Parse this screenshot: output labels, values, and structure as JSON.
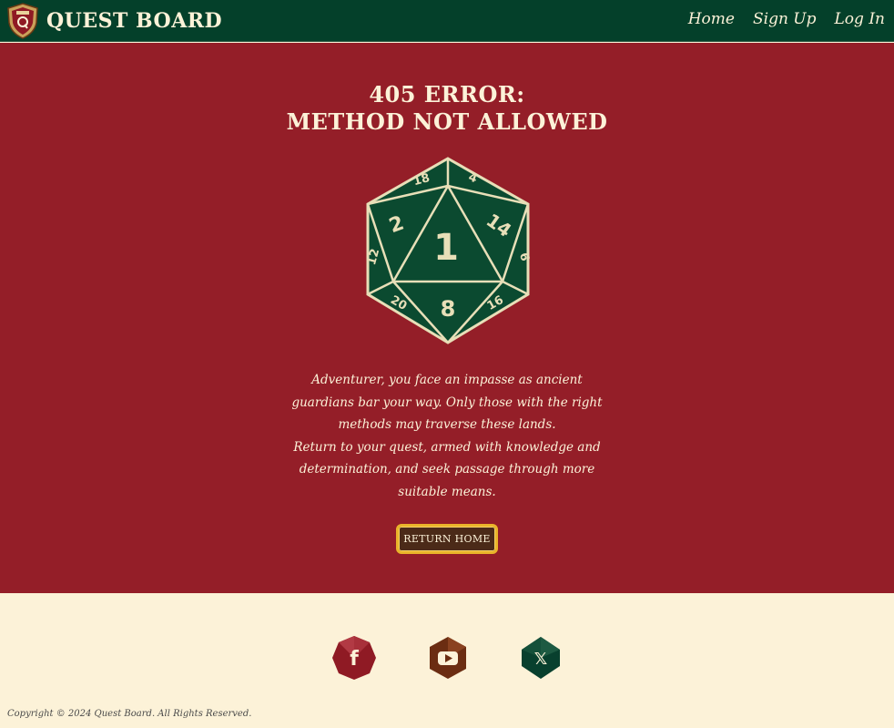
{
  "brand": {
    "name": "Quest Board",
    "logo_icon": "shield-logo-icon"
  },
  "nav": {
    "home": "Home",
    "sign_up": "Sign Up",
    "log_in": "Log In"
  },
  "error": {
    "title_line1": "405 Error:",
    "title_line2": "Method Not Allowed",
    "message_p1": "Adventurer, you face an impasse as ancient guardians bar your way. Only those with the right methods may traverse these lands.",
    "message_p2": "Return to your quest, armed with knowledge and determination, and seek passage through more suitable means.",
    "button": "Return Home"
  },
  "die": {
    "icon": "d20-die-icon",
    "faces": {
      "center": "1",
      "bottom": "8",
      "left": "2",
      "right": "14",
      "top_left": "18",
      "top_right": "4",
      "far_left": "12",
      "far_right": "6",
      "lower_left": "20",
      "lower_right": "16"
    }
  },
  "social": [
    {
      "name": "facebook",
      "icon": "facebook-icon",
      "glyph": "f",
      "color": "#8f1a24"
    },
    {
      "name": "youtube",
      "icon": "youtube-icon",
      "glyph": "▶",
      "color": "#6b2d12"
    },
    {
      "name": "x",
      "icon": "x-icon",
      "glyph": "𝕏",
      "color": "#08402e"
    }
  ],
  "footer": {
    "copyright": "Copyright © 2024 Quest Board. All Rights Reserved."
  },
  "colors": {
    "nav_bg": "#04402a",
    "main_bg": "#941e28",
    "footer_bg": "#fcf2d8",
    "cream": "#fcf2d8",
    "gold": "#eab42a",
    "die_green": "#0b4a30"
  }
}
